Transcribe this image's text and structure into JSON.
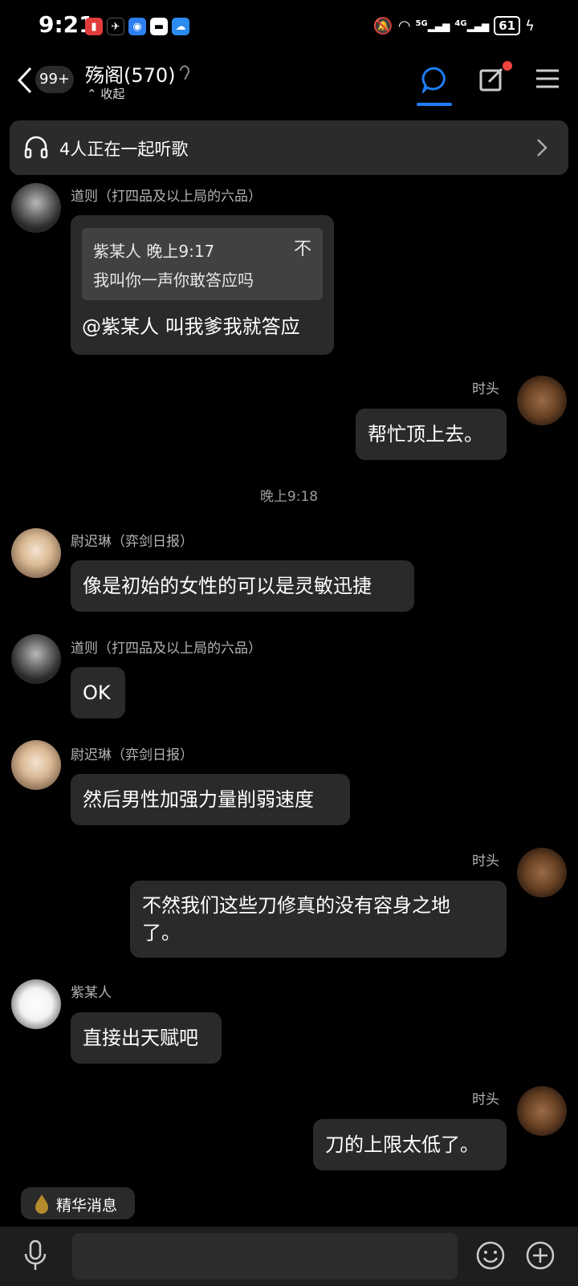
{
  "status": {
    "time": "9:21",
    "battery": "61",
    "network_5g": "5G",
    "network_4g": "4G"
  },
  "header": {
    "unread_badge": "99+",
    "group_title": "殇阁(570)",
    "collapse_label": "收起"
  },
  "banner": {
    "text": "4人正在一起听歌"
  },
  "messages": [
    {
      "sender": "道则（打四品及以上局的六品）",
      "quote": {
        "author_time": "紫某人 晚上9:17",
        "text": "我叫你一声你敢答应吗",
        "icon_text": "不"
      },
      "text": "@紫某人 叫我爹我就答应"
    },
    {
      "sender": "时头",
      "text": "帮忙顶上去。"
    },
    {
      "sender": "尉迟琳（弈剑日报）",
      "text": "像是初始的女性的可以是灵敏迅捷"
    },
    {
      "sender": "道则（打四品及以上局的六品）",
      "text": "OK"
    },
    {
      "sender": "尉迟琳（弈剑日报）",
      "text": "然后男性加强力量削弱速度"
    },
    {
      "sender": "时头",
      "text_line1": "不然我们这些刀修真的没有容身之地",
      "text_line2": "了。"
    },
    {
      "sender": "紫某人",
      "text": "直接出天赋吧"
    },
    {
      "sender": "时头",
      "text": "刀的上限太低了。"
    }
  ],
  "time_separator": "晚上9:18",
  "essence": {
    "label": "精华消息"
  },
  "colors": {
    "accent": "#1e7ef5",
    "bubble": "#2a2a2a",
    "background": "#000000",
    "notify_dot": "#f0423f"
  }
}
